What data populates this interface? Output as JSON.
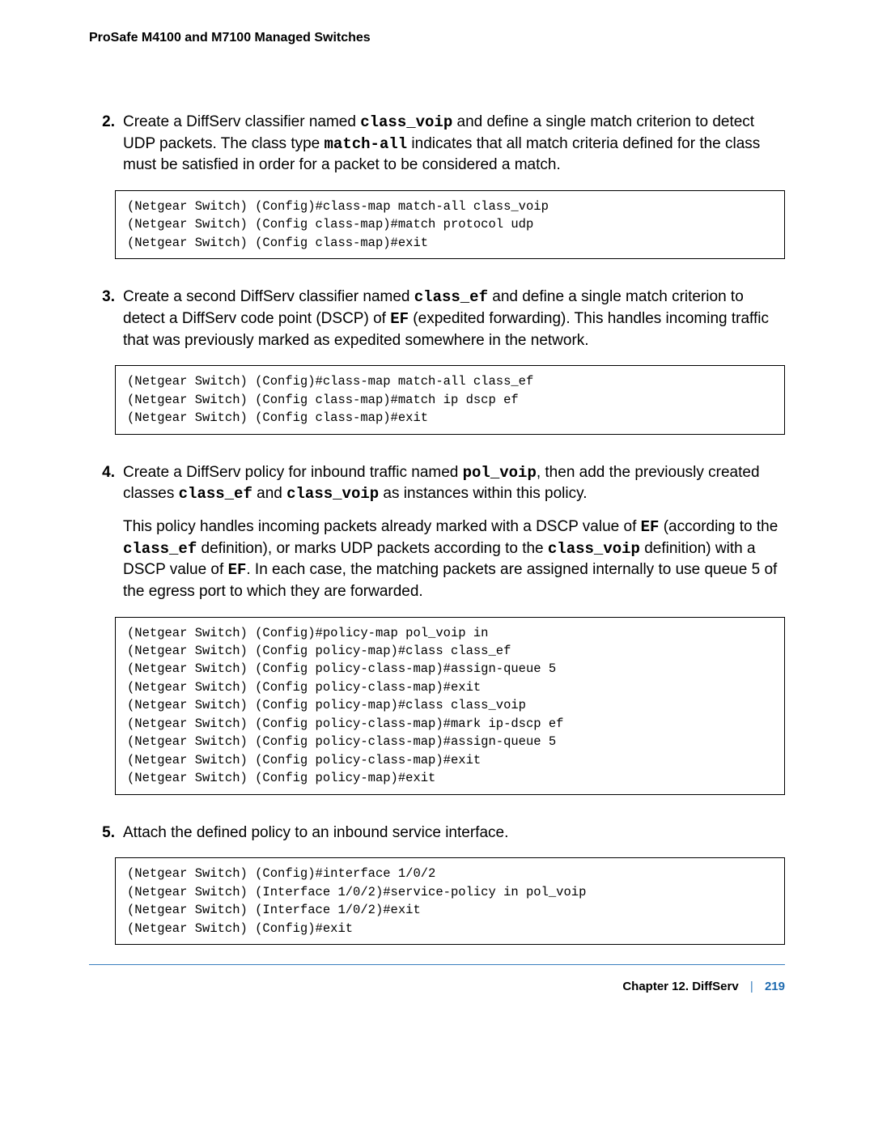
{
  "header": {
    "title": "ProSafe M4100 and M7100 Managed Switches"
  },
  "steps": [
    {
      "num": "2.",
      "paragraphs": [
        {
          "segments": [
            {
              "t": "Create a DiffServ classifier named "
            },
            {
              "t": "class_voip",
              "mono": true
            },
            {
              "t": " and define a single match criterion to detect UDP packets. The class type "
            },
            {
              "t": "match-all",
              "mono": true
            },
            {
              "t": " indicates that all match criteria defined for the class must be satisfied in order for a packet to be considered a match."
            }
          ]
        }
      ],
      "code": "(Netgear Switch) (Config)#class-map match-all class_voip\n(Netgear Switch) (Config class-map)#match protocol udp\n(Netgear Switch) (Config class-map)#exit"
    },
    {
      "num": "3.",
      "paragraphs": [
        {
          "segments": [
            {
              "t": "Create a second DiffServ classifier named "
            },
            {
              "t": "class_ef",
              "mono": true
            },
            {
              "t": " and define a single match criterion to detect a DiffServ code point (DSCP) of "
            },
            {
              "t": "EF",
              "mono": true
            },
            {
              "t": " (expedited forwarding). This handles incoming traffic that was previously marked as expedited somewhere in the network."
            }
          ]
        }
      ],
      "code": "(Netgear Switch) (Config)#class-map match-all class_ef\n(Netgear Switch) (Config class-map)#match ip dscp ef\n(Netgear Switch) (Config class-map)#exit"
    },
    {
      "num": "4.",
      "paragraphs": [
        {
          "segments": [
            {
              "t": "Create a DiffServ policy for inbound traffic named "
            },
            {
              "t": "pol_voip",
              "mono": true
            },
            {
              "t": ", then add the previously created classes "
            },
            {
              "t": "class_ef",
              "mono": true
            },
            {
              "t": " and "
            },
            {
              "t": "class_voip",
              "mono": true
            },
            {
              "t": " as instances within this policy."
            }
          ]
        },
        {
          "segments": [
            {
              "t": "This policy handles incoming packets already marked with a DSCP value of "
            },
            {
              "t": "EF",
              "mono": true
            },
            {
              "t": " (according to the "
            },
            {
              "t": "class_ef",
              "mono": true
            },
            {
              "t": " definition), or marks UDP packets according to the "
            },
            {
              "t": "class_voip",
              "mono": true
            },
            {
              "t": " definition) with a DSCP value of "
            },
            {
              "t": "EF",
              "mono": true
            },
            {
              "t": ". In each case, the matching packets are assigned internally to use queue 5 of the egress port to which they are forwarded."
            }
          ]
        }
      ],
      "code": "(Netgear Switch) (Config)#policy-map pol_voip in\n(Netgear Switch) (Config policy-map)#class class_ef\n(Netgear Switch) (Config policy-class-map)#assign-queue 5\n(Netgear Switch) (Config policy-class-map)#exit\n(Netgear Switch) (Config policy-map)#class class_voip\n(Netgear Switch) (Config policy-class-map)#mark ip-dscp ef\n(Netgear Switch) (Config policy-class-map)#assign-queue 5\n(Netgear Switch) (Config policy-class-map)#exit\n(Netgear Switch) (Config policy-map)#exit"
    },
    {
      "num": "5.",
      "paragraphs": [
        {
          "segments": [
            {
              "t": "Attach the defined policy to an inbound service interface."
            }
          ]
        }
      ],
      "code": "(Netgear Switch) (Config)#interface 1/0/2\n(Netgear Switch) (Interface 1/0/2)#service-policy in pol_voip\n(Netgear Switch) (Interface 1/0/2)#exit\n(Netgear Switch) (Config)#exit"
    }
  ],
  "footer": {
    "chapter_label": "Chapter 12.  DiffServ",
    "separator": "|",
    "page_number": "219"
  }
}
